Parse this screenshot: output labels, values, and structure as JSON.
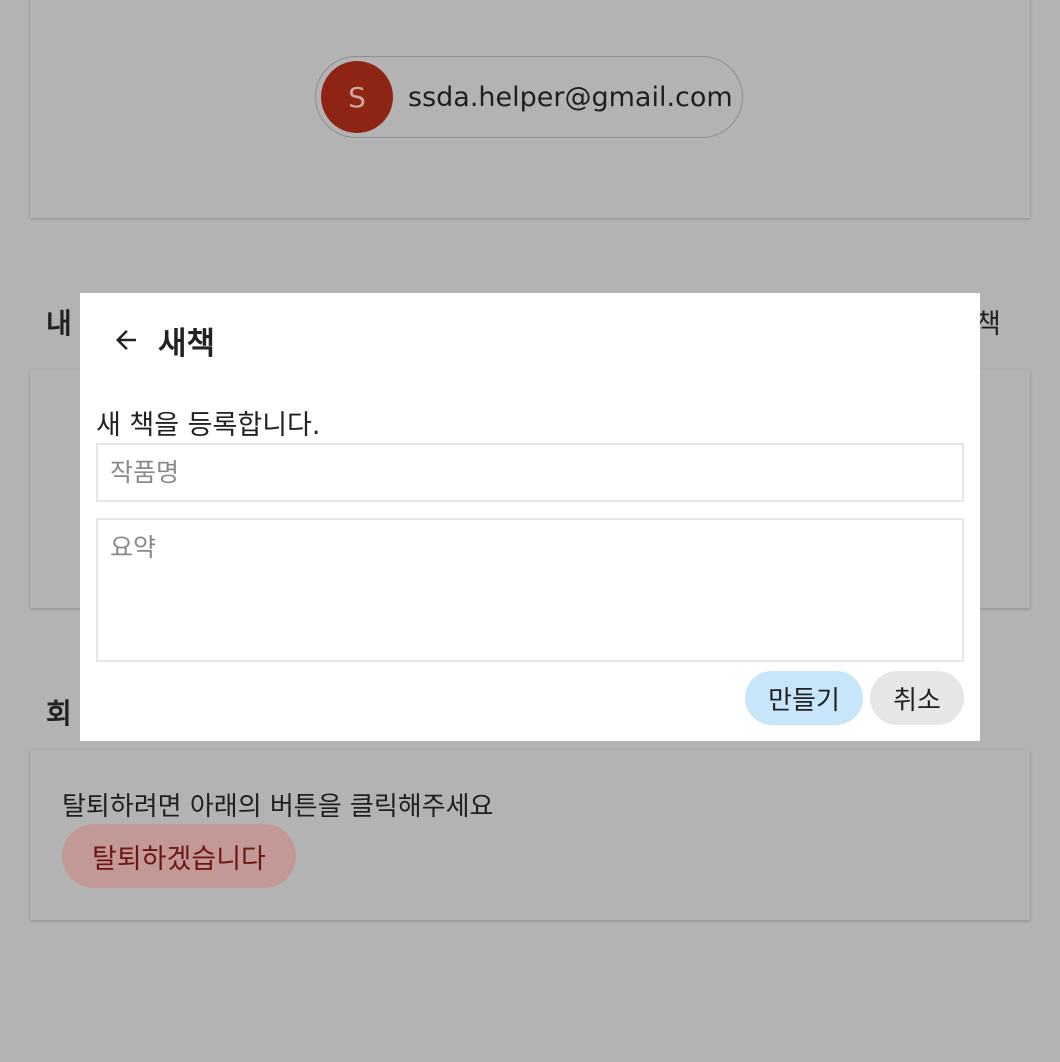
{
  "account": {
    "avatar_letter": "S",
    "email": "ssda.helper@gmail.com",
    "avatar_color": "#8e2414"
  },
  "books_section": {
    "title": "내",
    "new_book_link": "책"
  },
  "member_section": {
    "title": "회"
  },
  "withdraw": {
    "instruction": "탈퇴하려면 아래의 버튼을 클릭해주세요",
    "button_label": "탈퇴하겠습니다"
  },
  "modal": {
    "title": "새책",
    "description": "새 책을 등록합니다.",
    "title_placeholder": "작품명",
    "summary_placeholder": "요약",
    "create_label": "만들기",
    "cancel_label": "취소",
    "back_icon": "arrow-left-icon",
    "create_color": "#c8e6fa",
    "cancel_color": "#e6e6e6"
  },
  "colors": {
    "overlay_background": "#b3b3b3",
    "withdraw_button": "#c29996"
  }
}
